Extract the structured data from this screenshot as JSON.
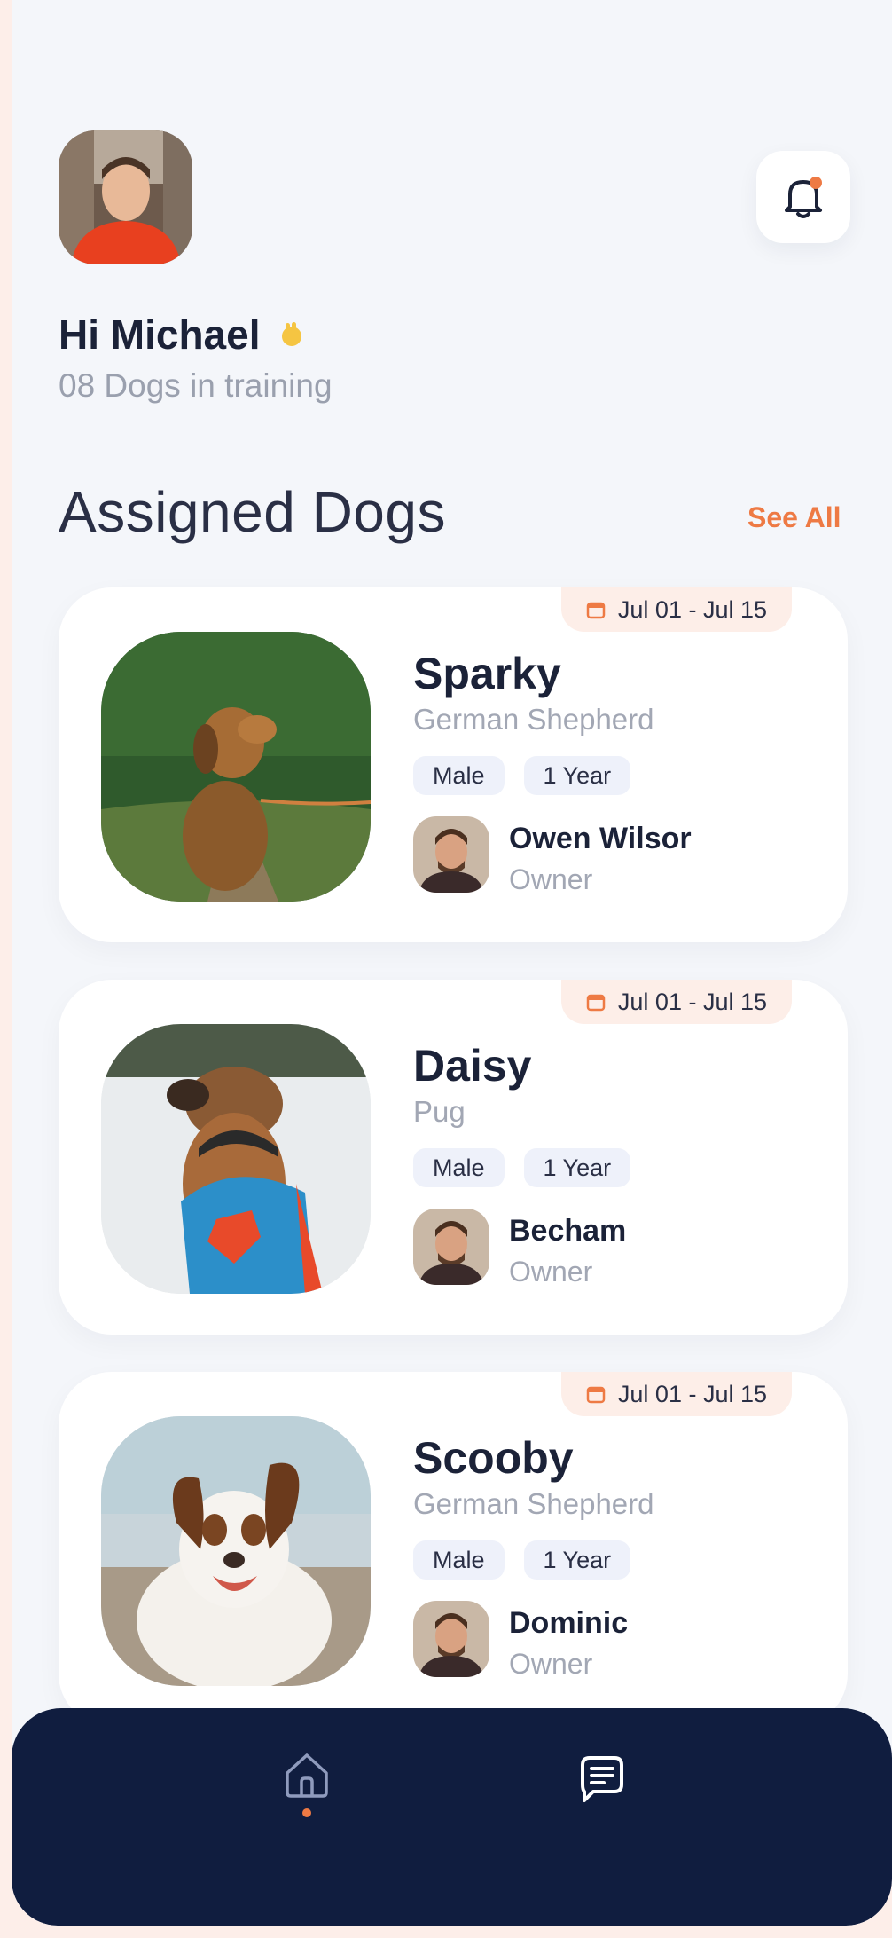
{
  "header": {
    "greeting": "Hi Michael",
    "subtitle": "08 Dogs in training",
    "profile_icon": "profile-photo",
    "notification_icon": "bell-icon",
    "notification_dot_color": "#ee7a44"
  },
  "section": {
    "title": "Assigned Dogs",
    "see_all": "See All"
  },
  "dogs": [
    {
      "date_range": "Jul 01 - Jul 15",
      "name": "Sparky",
      "breed": "German Shepherd",
      "gender": "Male",
      "age": "1 Year",
      "owner_name": "Owen Wilsor",
      "owner_role": "Owner"
    },
    {
      "date_range": "Jul 01 - Jul 15",
      "name": "Daisy",
      "breed": "Pug",
      "gender": "Male",
      "age": "1 Year",
      "owner_name": "Becham",
      "owner_role": "Owner"
    },
    {
      "date_range": "Jul 01 - Jul 15",
      "name": "Scooby",
      "breed": "German Shepherd",
      "gender": "Male",
      "age": "1 Year",
      "owner_name": "Dominic",
      "owner_role": "Owner"
    }
  ],
  "nav": {
    "items": [
      {
        "icon": "home-icon",
        "active": true
      },
      {
        "icon": "chat-icon",
        "active": false
      }
    ],
    "accent": "#ee7a44",
    "background": "#101d3f"
  }
}
